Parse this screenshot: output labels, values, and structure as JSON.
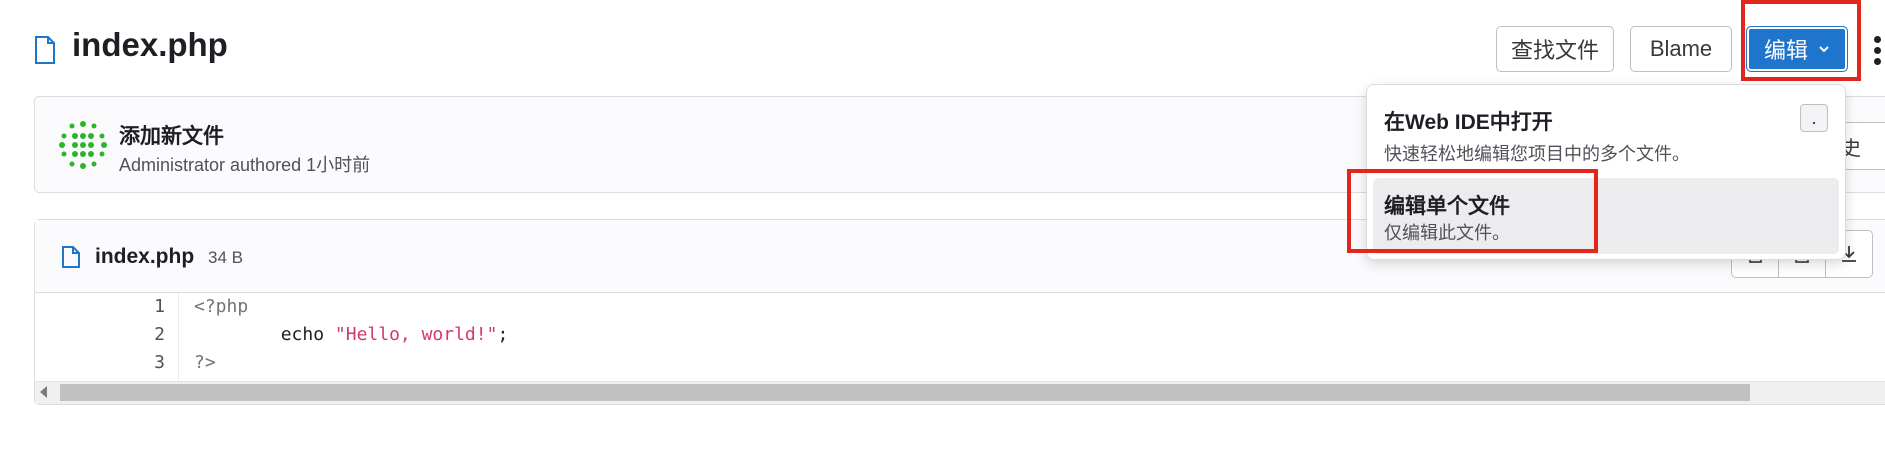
{
  "header": {
    "file_title": "index.php",
    "find_file_label": "查找文件",
    "blame_label": "Blame",
    "edit_label": "编辑"
  },
  "commit": {
    "title": "添加新文件",
    "meta": "Administrator authored 1小时前",
    "history_label": "史"
  },
  "file": {
    "name": "index.php",
    "size": "34 B",
    "line_numbers": [
      "1",
      "2",
      "3"
    ],
    "code": {
      "line1": "<?php",
      "line2_indent": "        echo ",
      "line2_string": "\"Hello, world!\"",
      "line2_end": ";",
      "line3": "?>"
    }
  },
  "edit_dropdown": {
    "web_ide_title": "在Web IDE中打开",
    "web_ide_desc": "快速轻松地编辑您项目中的多个文件。",
    "web_ide_shortcut": ".",
    "single_file_title": "编辑单个文件",
    "single_file_desc": "仅编辑此文件。"
  },
  "colors": {
    "primary": "#1f75cb",
    "highlight_box": "#e1261c",
    "string": "#d63865"
  },
  "icons": [
    "file-icon",
    "chevron-down-icon",
    "kebab-icon",
    "avatar-identicon",
    "download-icon",
    "copy-icon"
  ]
}
